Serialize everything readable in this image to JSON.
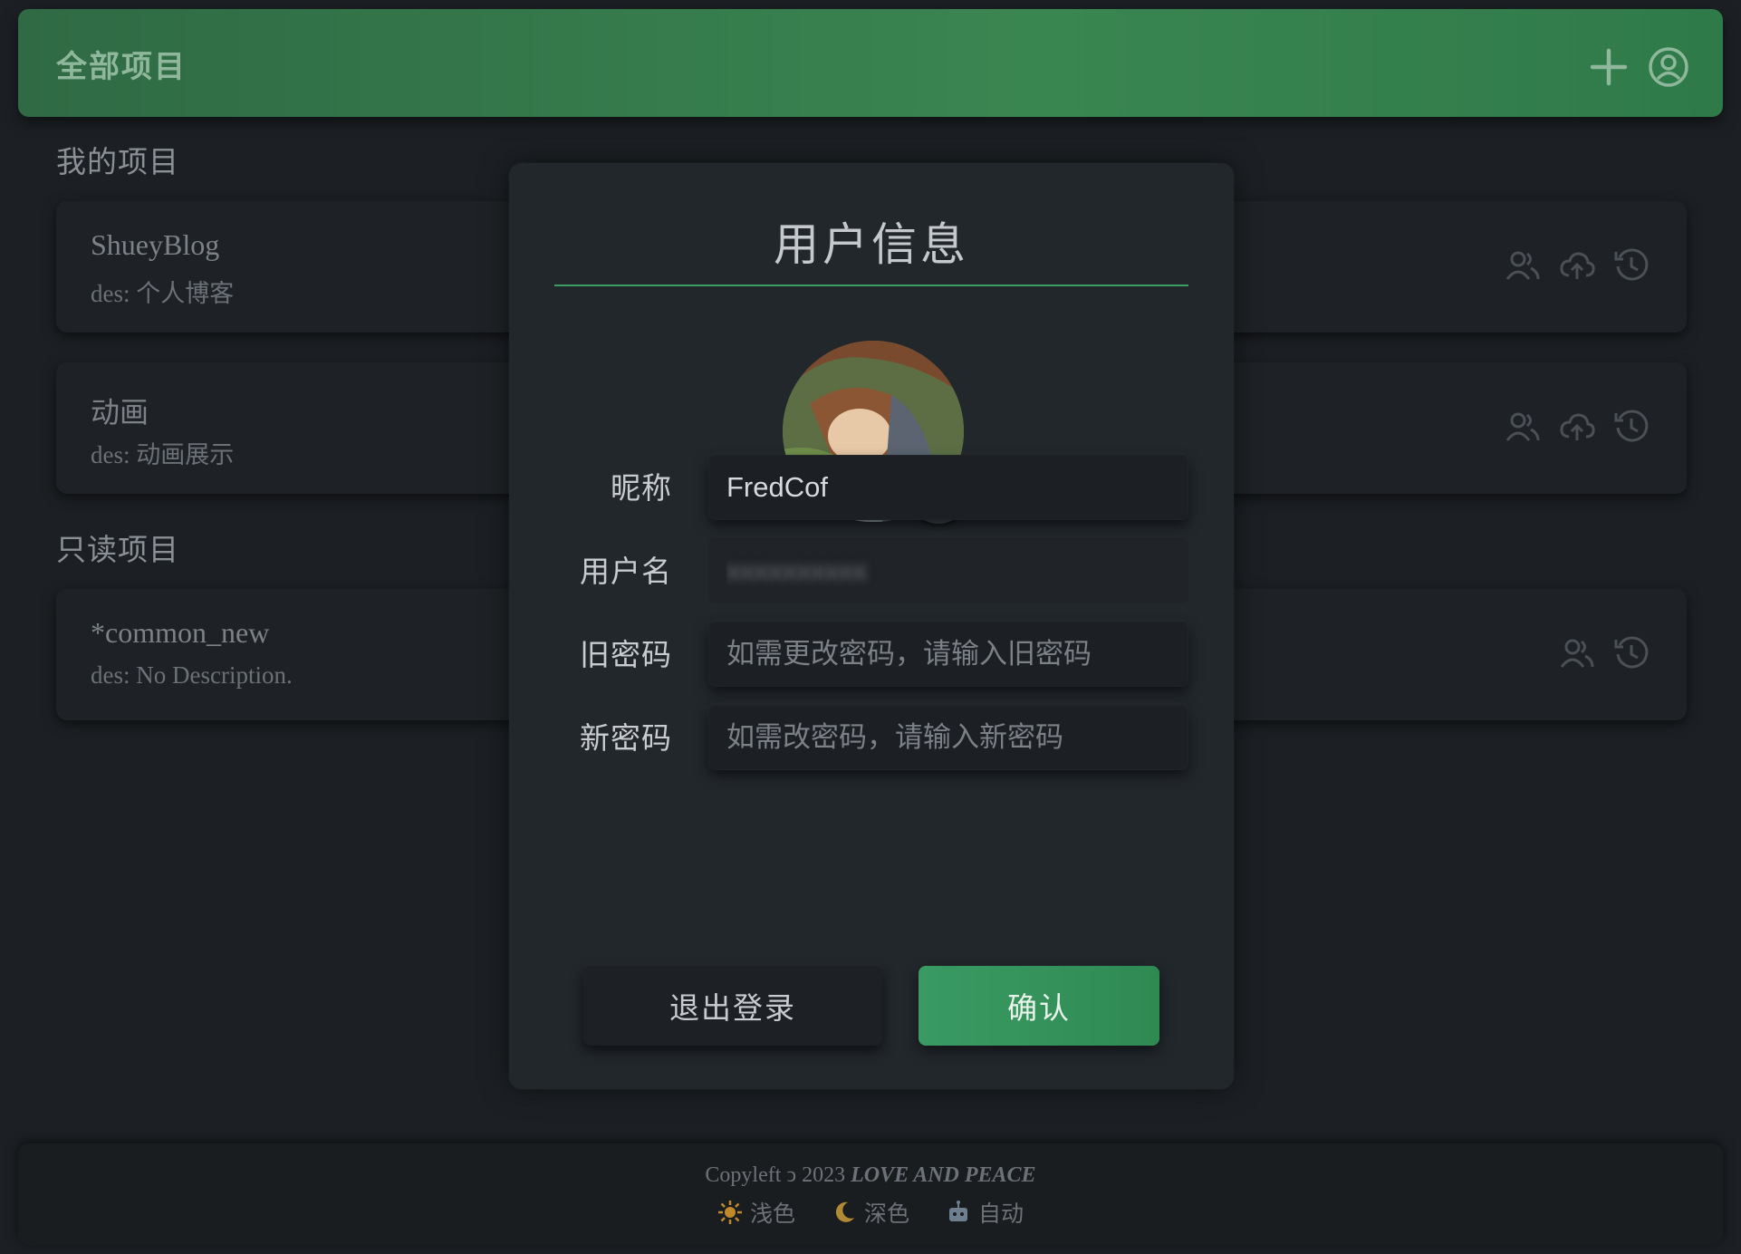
{
  "header": {
    "title": "全部项目",
    "add_icon": "plus-icon",
    "user_icon": "user-circle-icon"
  },
  "sections": {
    "mine_title": "我的项目",
    "readonly_title": "只读项目"
  },
  "projects_mine": [
    {
      "name": "ShueyBlog",
      "des": "des: 个人博客"
    },
    {
      "name": "动画",
      "des": "des: 动画展示"
    }
  ],
  "projects_readonly": [
    {
      "name": "*common_new",
      "des": "des: No Description."
    }
  ],
  "modal": {
    "title": "用户信息",
    "nickname_label": "昵称",
    "nickname_value": "FredCof",
    "username_label": "用户名",
    "username_value": "xxxxxxxxxx",
    "old_password_label": "旧密码",
    "old_password_placeholder": "如需更改密码，请输入旧密码",
    "new_password_label": "新密码",
    "new_password_placeholder": "如需改密码，请输入新密码",
    "logout_label": "退出登录",
    "confirm_label": "确认"
  },
  "footer": {
    "copyleft": "Copyleft ",
    "copyleft_symbol": "ↄ",
    "year": " 2023 ",
    "motto": "LOVE AND PEACE",
    "themes": [
      {
        "icon": "sun-icon",
        "label": "浅色"
      },
      {
        "icon": "moon-icon",
        "label": "深色"
      },
      {
        "icon": "robot-icon",
        "label": "自动"
      }
    ]
  },
  "colors": {
    "header_green": "#3a8651",
    "accent_green": "#3c9c62",
    "background": "#1c2024",
    "modal_bg": "#22272c"
  }
}
